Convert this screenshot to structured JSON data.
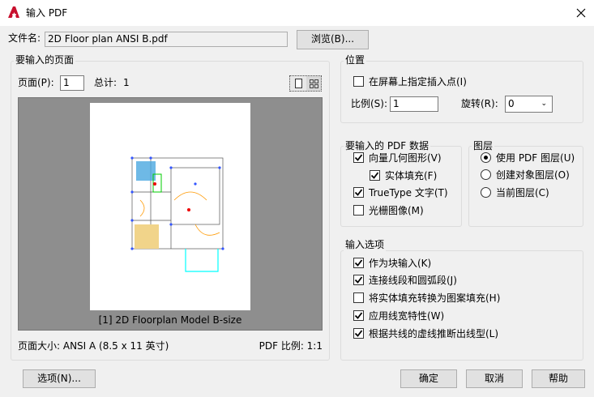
{
  "window": {
    "title": "输入 PDF",
    "icon": "autocad-logo-icon"
  },
  "file": {
    "label": "文件名:",
    "value": "2D Floor plan ANSI B.pdf",
    "browse": "浏览(B)..."
  },
  "pages": {
    "group_title": "要输入的页面",
    "page_label": "页面(P):",
    "page_value": "1",
    "total_label": "总计:",
    "total_value": "1",
    "preview_caption": "[1] 2D Floorplan Model B-size",
    "page_size": "页面大小: ANSI A (8.5 x 11 英寸)",
    "pdf_scale": "PDF 比例: 1:1"
  },
  "position": {
    "group_title": "位置",
    "specify_on_screen": {
      "label": "在屏幕上指定插入点(I)",
      "checked": false
    },
    "scale_label": "比例(S):",
    "scale_value": "1",
    "rotation_label": "旋转(R):",
    "rotation_value": "0"
  },
  "pdf_data": {
    "group_title": "要输入的 PDF 数据",
    "items": [
      {
        "label": "向量几何图形(V)",
        "checked": true
      },
      {
        "label": "实体填充(F)",
        "checked": true
      },
      {
        "label": "TrueType 文字(T)",
        "checked": true
      },
      {
        "label": "光栅图像(M)",
        "checked": false
      }
    ]
  },
  "layers": {
    "group_title": "图层",
    "options": [
      {
        "label": "使用 PDF 图层(U)",
        "selected": true
      },
      {
        "label": "创建对象图层(O)",
        "selected": false
      },
      {
        "label": "当前图层(C)",
        "selected": false
      }
    ]
  },
  "import_options": {
    "group_title": "输入选项",
    "items": [
      {
        "label": "作为块输入(K)",
        "checked": true
      },
      {
        "label": "连接线段和圆弧段(J)",
        "checked": true
      },
      {
        "label": "将实体填充转换为图案填充(H)",
        "checked": false
      },
      {
        "label": "应用线宽特性(W)",
        "checked": true
      },
      {
        "label": "根据共线的虚线推断出线型(L)",
        "checked": true
      }
    ]
  },
  "buttons": {
    "options": "选项(N)...",
    "ok": "确定",
    "cancel": "取消",
    "help": "帮助"
  }
}
